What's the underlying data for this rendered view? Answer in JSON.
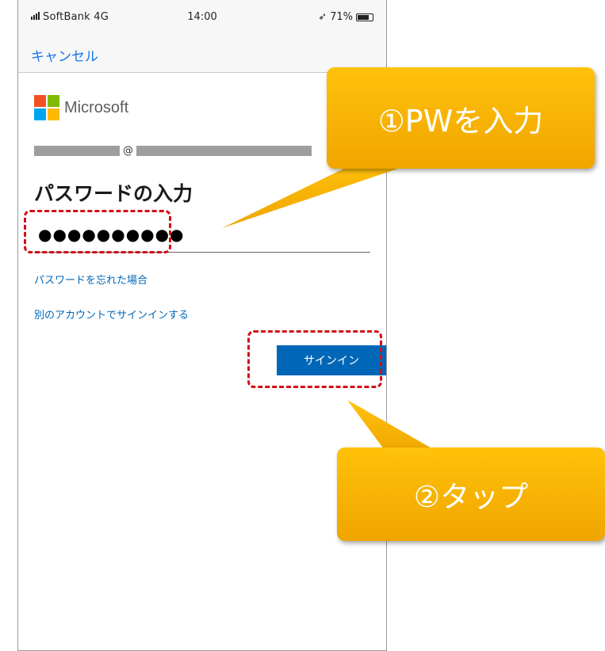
{
  "status_bar": {
    "carrier": "SoftBank 4G",
    "time": "14:00",
    "battery": "71%"
  },
  "nav": {
    "cancel_label": "キャンセル"
  },
  "brand": {
    "name": "Microsoft",
    "logo_colors": [
      "#f25022",
      "#7fba00",
      "#00a4ef",
      "#ffb900"
    ]
  },
  "account": {
    "at": "@"
  },
  "form": {
    "title": "パスワードの入力",
    "password_value": "●●●●●●●●●●",
    "forgot_link": "パスワードを忘れた場合",
    "other_account_link": "別のアカウントでサインインする",
    "signin_label": "サインイン"
  },
  "annotations": {
    "step1": "①PWを入力",
    "step2": "②タップ",
    "highlight_color": "#d20f16",
    "callout_color": "#f5b400"
  }
}
